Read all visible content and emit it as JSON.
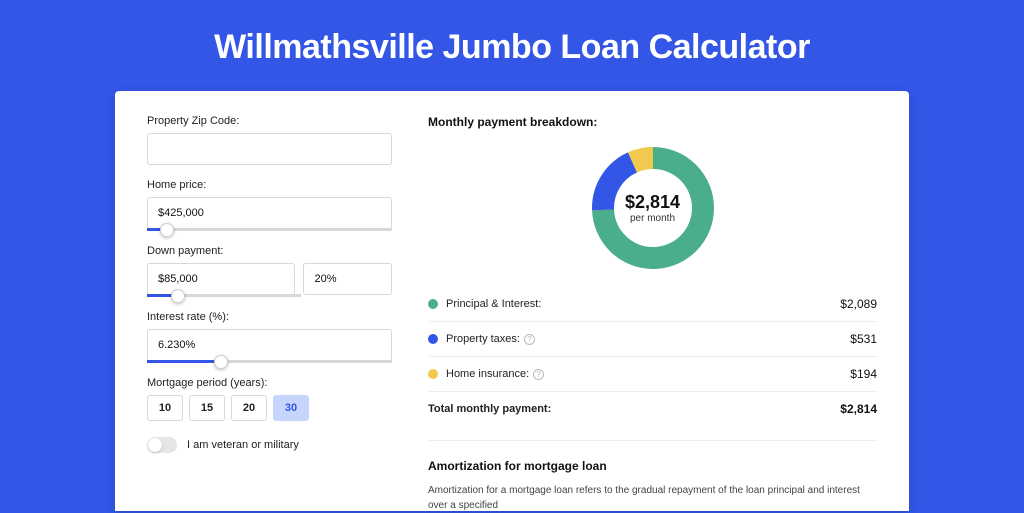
{
  "title": "Willmathsville Jumbo Loan Calculator",
  "form": {
    "zip": {
      "label": "Property Zip Code:",
      "value": ""
    },
    "home_price": {
      "label": "Home price:",
      "value": "$425,000",
      "slider_pct": 8
    },
    "down_payment": {
      "label": "Down payment:",
      "amount": "$85,000",
      "percent": "20%",
      "slider_pct": 20
    },
    "interest_rate": {
      "label": "Interest rate (%):",
      "value": "6.230%",
      "slider_pct": 30
    },
    "period": {
      "label": "Mortgage period (years):",
      "options": [
        "10",
        "15",
        "20",
        "30"
      ],
      "active": "30"
    },
    "veteran": {
      "label": "I am veteran or military",
      "checked": false
    }
  },
  "breakdown": {
    "title": "Monthly payment breakdown:",
    "center_amount": "$2,814",
    "center_sub": "per month",
    "items": [
      {
        "key": "principal",
        "label": "Principal & Interest:",
        "value": "$2,089",
        "color": "#4bae8a",
        "info": false
      },
      {
        "key": "taxes",
        "label": "Property taxes:",
        "value": "$531",
        "color": "#3356e6",
        "info": true
      },
      {
        "key": "insurance",
        "label": "Home insurance:",
        "value": "$194",
        "color": "#f1c94e",
        "info": true
      }
    ],
    "total_label": "Total monthly payment:",
    "total_value": "$2,814"
  },
  "amort": {
    "title": "Amortization for mortgage loan",
    "body": "Amortization for a mortgage loan refers to the gradual repayment of the loan principal and interest over a specified"
  },
  "chart_data": {
    "type": "pie",
    "title": "Monthly payment breakdown",
    "unit": "$/month",
    "series": [
      {
        "name": "Principal & Interest",
        "value": 2089,
        "color": "#4bae8a"
      },
      {
        "name": "Property taxes",
        "value": 531,
        "color": "#3356e6"
      },
      {
        "name": "Home insurance",
        "value": 194,
        "color": "#f1c94e"
      }
    ],
    "total": 2814
  }
}
